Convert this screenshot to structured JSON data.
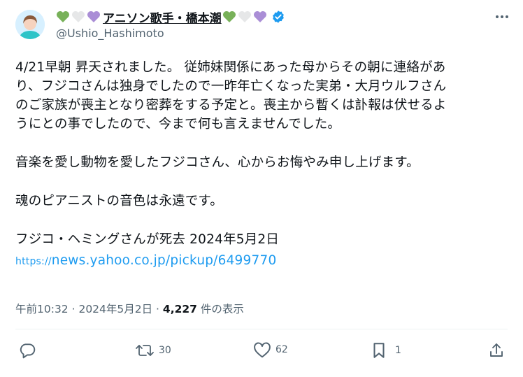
{
  "user": {
    "display_name": "アニソン歌手・橋本潮",
    "handle": "@Ushio_Hashimoto"
  },
  "tweet": {
    "paragraphs": [
      [
        "4/21早朝 昇天されました。 従姉妹関係にあった母からその朝に連絡があ",
        "り、フジコさんは独身でしたので一昨年亡くなった実弟・大月ウルフさん",
        "のご家族が喪主となり密葬をする予定と。喪主から暫くは訃報は伏せるよ",
        "うにとの事でしたので、今まで何も言えませんでした。"
      ],
      [
        "音楽を愛し動物を愛したフジコさん、心からお悔やみ申し上げます。"
      ],
      [
        "魂のピアニストの音色は永遠です。"
      ],
      [
        "フジコ・ヘミングさんが死去 2024年5月2日"
      ]
    ],
    "link_prefix": "https://",
    "link_text": "news.yahoo.co.jp/pickup/6499770"
  },
  "meta": {
    "time": "午前10:32",
    "sep": " · ",
    "date": "2024年5月2日",
    "views_count": "4,227",
    "views_label": " 件の表示"
  },
  "actions": {
    "reply": "",
    "retweets": "30",
    "likes": "62",
    "bookmarks": "1"
  },
  "icons": {
    "hearts_left": [
      "green-heart-icon",
      "white-heart-icon",
      "purple-heart-icon"
    ],
    "hearts_right": [
      "green-heart-icon",
      "white-heart-icon",
      "purple-heart-icon"
    ],
    "verified": "verified-badge-icon",
    "more": "more-icon",
    "reply": "reply-icon",
    "retweet": "retweet-icon",
    "like": "like-icon",
    "bookmark": "bookmark-icon",
    "share": "share-icon"
  },
  "colors": {
    "green_heart": "#78b159",
    "white_heart": "#e6e7e8",
    "purple_heart": "#aa8ed6",
    "verified": "#1d9bf0",
    "link": "#1d9bf0",
    "muted": "#536471"
  }
}
